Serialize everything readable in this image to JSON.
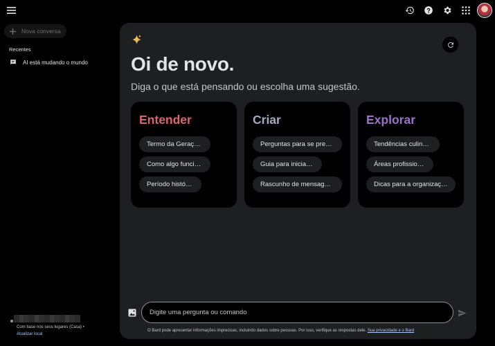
{
  "sidebar": {
    "new_chat_label": "Nova conversa",
    "recent_heading": "Recentes",
    "recent_items": [
      {
        "label": "AI está mudando o mundo"
      }
    ],
    "location": {
      "line1": "Com base nos seus lugares (Casa) •",
      "update_link": "Atualizar local"
    }
  },
  "main": {
    "greeting": "Oi de novo.",
    "subtitle": "Diga o que está pensando ou escolha uma sugestão.",
    "cards": [
      {
        "title": "Entender",
        "color": "#d96570",
        "chips": [
          "Termo da Geração Z",
          "Como algo funciona",
          "Período histórico"
        ]
      },
      {
        "title": "Criar",
        "color": "#a6aac0",
        "chips": [
          "Perguntas para se preparar para uma entrevista",
          "Guia para iniciantes",
          "Rascunho de mensagem de e-mail"
        ]
      },
      {
        "title": "Explorar",
        "color": "#9b72cb",
        "chips": [
          "Tendências culinárias",
          "Áreas profissionais",
          "Dicas para a organização da casa"
        ]
      }
    ],
    "prompt_placeholder": "Digite uma pergunta ou comando",
    "disclaimer": "O Bard pode apresentar informações imprecisas, incluindo dados sobre pessoas. Por isso, verifique as respostas dele.",
    "privacy_link": "Sua privacidade e o Bard"
  },
  "colors": {
    "background": "#000000",
    "panel": "#1e1f20",
    "accent_link": "#a8c7fa"
  }
}
